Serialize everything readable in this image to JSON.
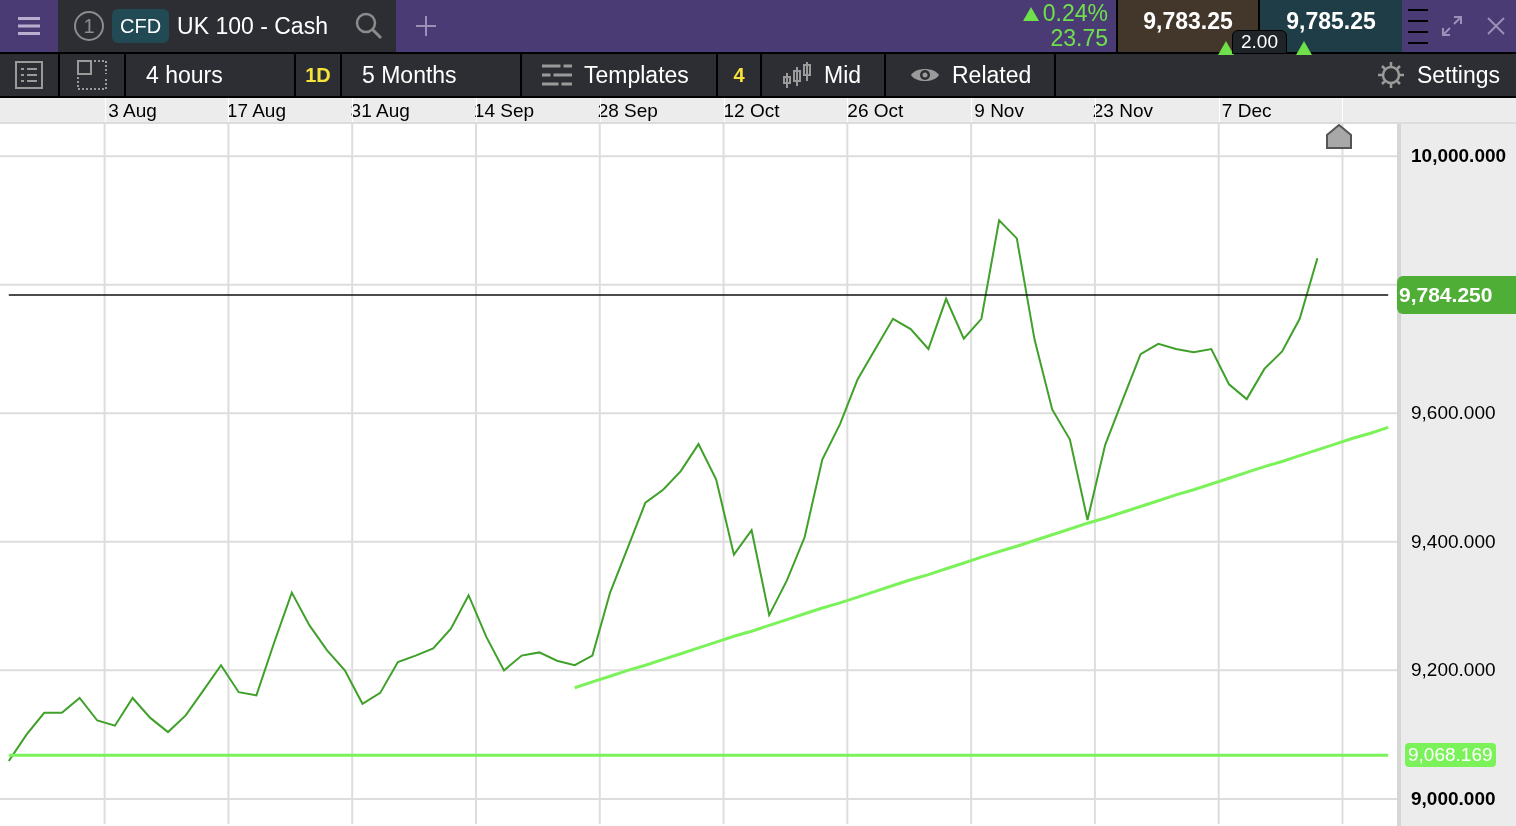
{
  "header": {
    "tab": {
      "number": "1",
      "badge": "CFD",
      "title": "UK 100 - Cash"
    },
    "change": {
      "rising": true,
      "percent": "0.24%",
      "points": "23.75"
    },
    "sell": {
      "price": "9,783.25",
      "rising": true
    },
    "buy": {
      "price": "9,785.25",
      "rising": true
    },
    "spread": "2.00"
  },
  "toolbar": {
    "interval": "4 hours",
    "interval_badge": "1D",
    "range": "5 Months",
    "templates": "Templates",
    "templates_count": "4",
    "price_type": "Mid",
    "related": "Related",
    "settings": "Settings"
  },
  "chart": {
    "current_price_label": "9,784.250",
    "support_label": "9,068.169",
    "chart_data": {
      "type": "line",
      "categories": [
        null,
        null,
        null,
        null,
        null,
        null,
        null,
        "3 Aug",
        null,
        null,
        null,
        null,
        null,
        null,
        "17 Aug",
        null,
        null,
        null,
        null,
        null,
        null,
        "31 Aug",
        null,
        null,
        null,
        null,
        null,
        null,
        "14 Sep",
        null,
        null,
        null,
        null,
        null,
        null,
        "28 Sep",
        null,
        null,
        null,
        null,
        null,
        null,
        "12 Oct",
        null,
        null,
        null,
        null,
        null,
        null,
        "26 Oct",
        null,
        null,
        null,
        null,
        null,
        null,
        "9 Nov",
        null,
        null,
        null,
        null,
        null,
        null,
        "23 Nov",
        null,
        null,
        null,
        null,
        null,
        null,
        "7 Dec",
        null,
        null,
        null,
        null,
        null,
        null,
        null,
        null
      ],
      "series": [
        {
          "color": "#3fa02a",
          "values": [
            9059,
            9100,
            9134,
            9134,
            9157,
            9122,
            9114,
            9157,
            9126,
            9104,
            9130,
            9169,
            9208,
            9166,
            9161,
            9243,
            9321,
            9270,
            9231,
            9200,
            9148,
            9165,
            9213,
            9223,
            9234,
            9265,
            9317,
            9252,
            9200,
            9223,
            9228,
            9215,
            9208,
            9223,
            9321,
            9391,
            9461,
            9481,
            9510,
            9552,
            9497,
            9380,
            9418,
            9286,
            9340,
            9407,
            9528,
            9583,
            9653,
            9700,
            9747,
            9731,
            9700,
            9778,
            9716,
            9747,
            9900,
            9872,
            9715,
            9606,
            9559,
            9434,
            9551,
            9622,
            9692,
            9708,
            9700,
            9695,
            9700,
            9645,
            9622,
            9669,
            9696,
            9747,
            9841,
            null,
            null,
            null,
            null
          ]
        },
        {
          "color": "#111111",
          "values": [
            9784,
            9784,
            9784,
            9784,
            9784,
            9784,
            9784,
            9784,
            9784,
            9784,
            9784,
            9784,
            9784,
            9784,
            9784,
            9784,
            9784,
            9784,
            9784,
            9784,
            9784,
            9784,
            9784,
            9784,
            9784,
            9784,
            9784,
            9784,
            9784,
            9784,
            9784,
            9784,
            9784,
            9784,
            9784,
            9784,
            9784,
            9784,
            9784,
            9784,
            9784,
            9784,
            9784,
            9784,
            9784,
            9784,
            9784,
            9784,
            9784,
            9784,
            9784,
            9784,
            9784,
            9784,
            9784,
            9784,
            9784,
            9784,
            9784,
            9784,
            9784,
            9784,
            9784,
            9784,
            9784,
            9784,
            9784,
            9784,
            9784,
            9784,
            9784,
            9784,
            9784,
            9784,
            9784,
            9784,
            9784,
            9784,
            9784
          ]
        },
        {
          "color": "#7cf25a",
          "values": [
            9068,
            9068,
            9068,
            9068,
            9068,
            9068,
            9068,
            9068,
            9068,
            9068,
            9068,
            9068,
            9068,
            9068,
            9068,
            9068,
            9068,
            9068,
            9068,
            9068,
            9068,
            9068,
            9068,
            9068,
            9068,
            9068,
            9068,
            9068,
            9068,
            9068,
            9068,
            9068,
            9068,
            9068,
            9068,
            9068,
            9068,
            9068,
            9068,
            9068,
            9068,
            9068,
            9068,
            9068,
            9068,
            9068,
            9068,
            9068,
            9068,
            9068,
            9068,
            9068,
            9068,
            9068,
            9068,
            9068,
            9068,
            9068,
            9068,
            9068,
            9068,
            9068,
            9068,
            9068,
            9068,
            9068,
            9068,
            9068,
            9068,
            9068,
            9068,
            9068,
            9068,
            9068,
            9068,
            9068,
            9068,
            9068,
            9068
          ]
        },
        {
          "color": "#7cf25a",
          "values": [
            null,
            null,
            null,
            null,
            null,
            null,
            null,
            null,
            null,
            null,
            null,
            null,
            null,
            null,
            null,
            null,
            null,
            null,
            null,
            null,
            null,
            null,
            null,
            null,
            null,
            null,
            null,
            null,
            null,
            null,
            null,
            null,
            9173,
            9182,
            9191,
            9200,
            9208,
            9217,
            9226,
            9235,
            9244,
            9253,
            9261,
            9270,
            9279,
            9288,
            9297,
            9305,
            9314,
            9323,
            9332,
            9341,
            9349,
            9358,
            9367,
            9376,
            9385,
            9393,
            9402,
            9411,
            9420,
            9429,
            9437,
            9446,
            9455,
            9464,
            9473,
            9481,
            9490,
            9499,
            9508,
            9517,
            9525,
            9534,
            9543,
            9552,
            9561,
            9569,
            9578
          ]
        }
      ],
      "grid": true,
      "ylim": [
        8961,
        10050
      ],
      "yticks": [
        {
          "value": 10000,
          "label": "10,000.000"
        },
        {
          "value": 9600,
          "label": "9,600.000"
        },
        {
          "value": 9400,
          "label": "9,400.000"
        },
        {
          "value": 9200,
          "label": "9,200.000"
        },
        {
          "value": 9000,
          "label": "9,000.000"
        }
      ]
    }
  }
}
